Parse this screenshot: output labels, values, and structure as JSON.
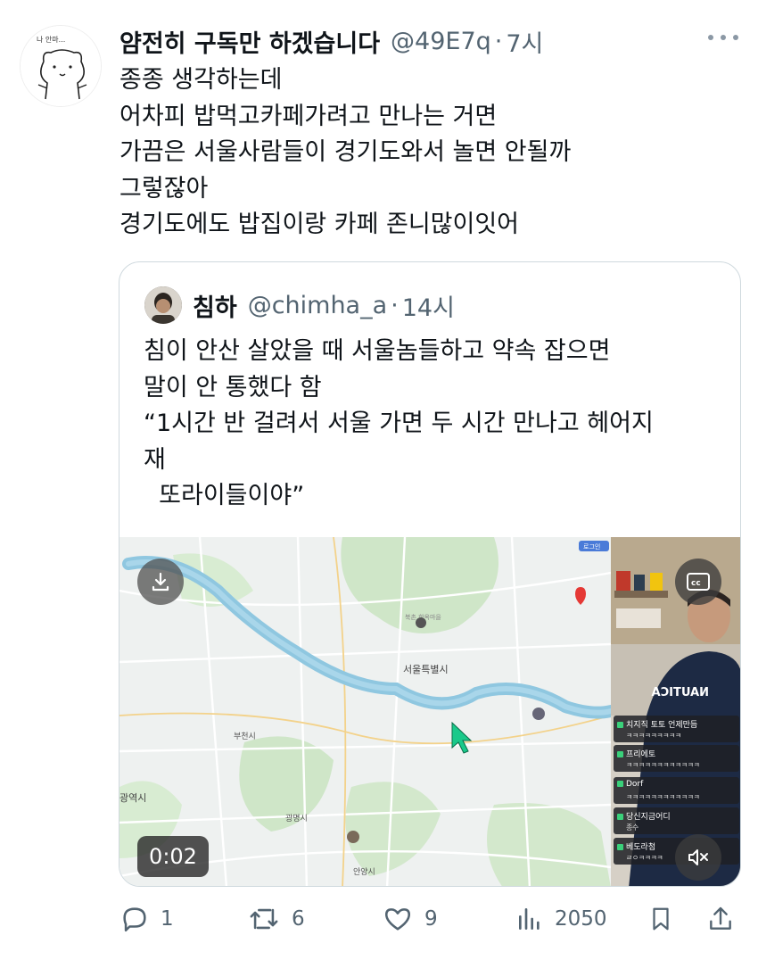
{
  "tweet": {
    "author_name": "얌전히 구독만 하겠습니다",
    "author_handle": "@49E7q",
    "separator": "·",
    "time": "7시",
    "avatar_caption": "나 안마...",
    "lines": [
      "종종 생각하는데",
      "어차피 밥먹고카페가려고 만나는 거면",
      "가끔은 서울사람들이 경기도와서 놀면 안될까",
      "그렇잖아",
      "경기도에도 밥집이랑 카페 존니많이잇어"
    ]
  },
  "quote": {
    "author_name": "침하",
    "author_handle": "@chimha_a",
    "separator": "·",
    "time": "14시",
    "lines": [
      "침이 안산 살았을 때 서울놈들하고 약속 잡으면",
      "말이 안 통했다 함",
      "“1시간 반 걸려서 서울 가면 두 시간 만나고 헤어지",
      "재",
      "  또라이들이야”"
    ],
    "video": {
      "timecode": "0:02",
      "map_labels": {
        "seoul": "서울특별시",
        "bucheon": "부천시",
        "gwangmyeong": "광명시",
        "anyang": "안양시",
        "incheon_partial": "광역시",
        "bukchon": "북촌 한옥마을",
        "badge": "로그인"
      },
      "streamer_shirt_text": "NAUTICA",
      "chat": [
        {
          "user": "치지직 토토 언제만듬",
          "msg": "ㅋㅋㅋㅋㅋㅋㅋㅋㅋ"
        },
        {
          "user": "프리에토",
          "msg": "ㅋㅋㅋㅋㅋㅋㅋㅋㅋㅋㅋㅋ"
        },
        {
          "user": "Dorf",
          "msg": "ㅋㅋㅋㅋㅋㅋㅋㅋㅋㅋㅋㅋ"
        },
        {
          "user": "당신지금어디",
          "msg": "종수"
        },
        {
          "user": "베도라첨",
          "msg": "ㄹㅇㅋㅋㅋㅋ"
        }
      ]
    }
  },
  "actions": {
    "reply_count": "1",
    "retweet_count": "6",
    "like_count": "9",
    "view_count": "2050"
  },
  "colors": {
    "text_primary": "#0f1419",
    "text_secondary": "#536471",
    "border": "#cfd9de",
    "river": "#8fc7e0",
    "green_area": "#cfe6c8"
  }
}
